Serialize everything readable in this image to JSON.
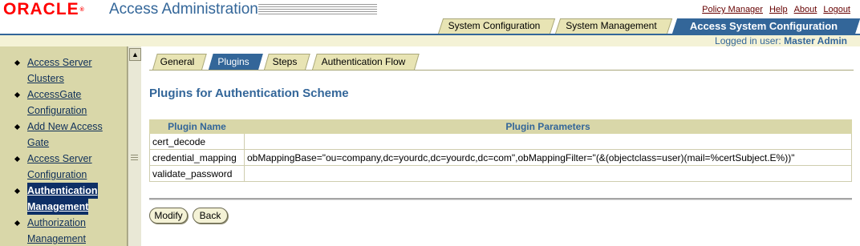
{
  "header": {
    "logo_text": "ORACLE",
    "logo_mark": "®",
    "app_title": "Access Administration",
    "links": [
      "Policy Manager",
      "Help",
      "About",
      "Logout"
    ],
    "tabs": [
      {
        "label": "System Configuration"
      },
      {
        "label": "System Management"
      },
      {
        "label": "Access System Configuration",
        "active": true
      }
    ],
    "logged_in_label": "Logged in user:",
    "logged_in_user": "Master Admin"
  },
  "sidebar": {
    "items": [
      {
        "lines": [
          "Access Server",
          "Clusters"
        ]
      },
      {
        "lines": [
          "AccessGate",
          "Configuration"
        ]
      },
      {
        "lines": [
          "Add New Access",
          "Gate"
        ]
      },
      {
        "lines": [
          "Access Server",
          "Configuration"
        ]
      },
      {
        "lines": [
          "Authentication",
          "Management"
        ],
        "active": true
      },
      {
        "lines": [
          "Authorization",
          "Management"
        ]
      }
    ]
  },
  "subtabs": [
    {
      "label": "General"
    },
    {
      "label": "Plugins",
      "active": true
    },
    {
      "label": "Steps"
    },
    {
      "label": "Authentication Flow"
    }
  ],
  "main": {
    "title": "Plugins for Authentication Scheme",
    "table": {
      "headers": [
        "Plugin Name",
        "Plugin Parameters"
      ],
      "rows": [
        [
          "cert_decode",
          ""
        ],
        [
          "credential_mapping",
          "obMappingBase=\"ou=company,dc=yourdc,dc=yourdc,dc=com\",obMappingFilter=\"(&(objectclass=user)(mail=%certSubject.E%))\""
        ],
        [
          "validate_password",
          ""
        ]
      ]
    },
    "buttons": {
      "modify": "Modify",
      "back": "Back"
    }
  },
  "colors": {
    "brand_red": "#ff0000",
    "accent_blue": "#336699",
    "sidebar_bg": "#d9d7a9",
    "tab_bg": "#e8e4b4",
    "active_nav": "#0e2f66"
  },
  "icons": {
    "scroll_up": "scroll-up-arrow-icon",
    "bullet": "diamond-bullet-icon"
  }
}
